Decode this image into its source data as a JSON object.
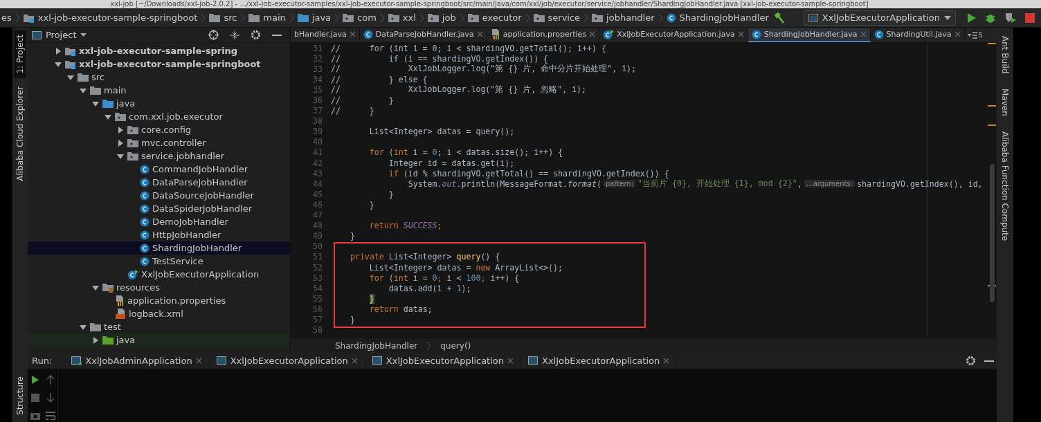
{
  "window": {
    "title": "xxl-job [~/Downloads/xxl-job-2.0.2] - .../xxl-job-executor-samples/xxl-job-executor-sample-springboot/src/main/java/com/xxl/job/executor/service/jobhandler/ShardingJobHandler.java [xxl-job-executor-sample-springboot]"
  },
  "navbar": {
    "crumbs": [
      {
        "label": "es",
        "kind": "none"
      },
      {
        "label": "xxl-job-executor-sample-springboot",
        "kind": "module"
      },
      {
        "label": "src",
        "kind": "folder"
      },
      {
        "label": "main",
        "kind": "folder"
      },
      {
        "label": "java",
        "kind": "source"
      },
      {
        "label": "com",
        "kind": "package"
      },
      {
        "label": "xxl",
        "kind": "package"
      },
      {
        "label": "job",
        "kind": "package"
      },
      {
        "label": "executor",
        "kind": "package"
      },
      {
        "label": "service",
        "kind": "package"
      },
      {
        "label": "jobhandler",
        "kind": "package"
      },
      {
        "label": "ShardingJobHandler",
        "kind": "class"
      }
    ],
    "run_config": "XxlJobExecutorApplication"
  },
  "left_stripe": {
    "top": [
      {
        "label": "1: Project",
        "selected": true
      },
      {
        "label": "Alibaba Cloud Explorer",
        "selected": false
      }
    ],
    "bottom": [
      {
        "label": "Structure",
        "selected": false
      }
    ]
  },
  "right_stripe": [
    {
      "label": "Ant Build"
    },
    {
      "label": "Maven"
    },
    {
      "label": "Alibaba Function Compute"
    }
  ],
  "project": {
    "title": "Project",
    "tree": [
      {
        "label": "xxl-job-executor-sample-spring",
        "kind": "module",
        "expanded": false,
        "selected": false
      },
      {
        "label": "xxl-job-executor-sample-springboot",
        "kind": "module",
        "expanded": true,
        "selected": false,
        "children": [
          {
            "label": "src",
            "kind": "folder",
            "expanded": true,
            "selected": false,
            "children": [
              {
                "label": "main",
                "kind": "folder",
                "expanded": true,
                "selected": false,
                "children": [
                  {
                    "label": "java",
                    "kind": "source",
                    "expanded": true,
                    "selected": false,
                    "children": [
                      {
                        "label": "com.xxl.job.executor",
                        "kind": "package",
                        "expanded": true,
                        "selected": false,
                        "children": [
                          {
                            "label": "core.config",
                            "kind": "package",
                            "expanded": false,
                            "selected": false
                          },
                          {
                            "label": "mvc.controller",
                            "kind": "package",
                            "expanded": false,
                            "selected": false
                          },
                          {
                            "label": "service.jobhandler",
                            "kind": "package",
                            "expanded": true,
                            "selected": false,
                            "children": [
                              {
                                "label": "CommandJobHandler",
                                "kind": "class",
                                "selected": false
                              },
                              {
                                "label": "DataParseJobHandler",
                                "kind": "class",
                                "selected": false
                              },
                              {
                                "label": "DataSourceJobHandler",
                                "kind": "class",
                                "selected": false
                              },
                              {
                                "label": "DataSpiderJobHandler",
                                "kind": "class",
                                "selected": false
                              },
                              {
                                "label": "DemoJobHandler",
                                "kind": "class",
                                "selected": false
                              },
                              {
                                "label": "HttpJobHandler",
                                "kind": "class",
                                "selected": false
                              },
                              {
                                "label": "ShardingJobHandler",
                                "kind": "class",
                                "selected": true
                              },
                              {
                                "label": "TestService",
                                "kind": "class",
                                "selected": false
                              }
                            ]
                          },
                          {
                            "label": "XxlJobExecutorApplication",
                            "kind": "app",
                            "selected": false
                          }
                        ]
                      }
                    ]
                  },
                  {
                    "label": "resources",
                    "kind": "resources",
                    "expanded": true,
                    "selected": false,
                    "children": [
                      {
                        "label": "application.properties",
                        "kind": "properties",
                        "selected": false
                      },
                      {
                        "label": "logback.xml",
                        "kind": "xml",
                        "selected": false
                      }
                    ]
                  }
                ]
              },
              {
                "label": "test",
                "kind": "folder",
                "expanded": true,
                "selected": false,
                "children": [
                  {
                    "label": "java",
                    "kind": "test",
                    "expanded": false,
                    "selected": false
                  }
                ]
              }
            ]
          }
        ]
      }
    ]
  },
  "editor": {
    "tabs": [
      {
        "label": "bHandler.java",
        "selected": false
      },
      {
        "label": "DataParseJobHandler.java",
        "kind": "class",
        "selected": false
      },
      {
        "label": "application.properties",
        "kind": "properties",
        "selected": false
      },
      {
        "label": "XxlJobExecutorApplication.java",
        "kind": "app",
        "selected": false
      },
      {
        "label": "ShardingJobHandler.java",
        "kind": "class",
        "selected": true
      },
      {
        "label": "ShardingUtil.java",
        "kind": "class",
        "selected": false
      }
    ],
    "overflow_count": "5",
    "lines": [
      {
        "no": "31",
        "tokens": [
          {
            "kind": "plain",
            "text": "//      for (int i = 0; i < shardingVO.getTotal(); i++) {"
          }
        ]
      },
      {
        "no": "32",
        "tokens": [
          {
            "kind": "plain",
            "text": "//          if (i == shardingVO.getIndex()) {"
          }
        ]
      },
      {
        "no": "33",
        "tokens": [
          {
            "kind": "plain",
            "text": "//              XxlJobLogger.log(\"第 {} 片, 命中分片开始处理\", i);"
          }
        ]
      },
      {
        "no": "34",
        "tokens": [
          {
            "kind": "plain",
            "text": "//          } else {"
          }
        ]
      },
      {
        "no": "35",
        "tokens": [
          {
            "kind": "plain",
            "text": "//              XxlJobLogger.log(\"第 {} 片, 忽略\", i);"
          }
        ]
      },
      {
        "no": "36",
        "tokens": [
          {
            "kind": "plain",
            "text": "//          }"
          }
        ]
      },
      {
        "no": "37",
        "tokens": [
          {
            "kind": "plain",
            "text": "//      }"
          }
        ]
      },
      {
        "no": "38"
      },
      {
        "no": "39",
        "tokens": [
          {
            "kind": "plain",
            "text": "        List<Integer> datas = query();"
          }
        ]
      },
      {
        "no": "40"
      },
      {
        "no": "41",
        "tokens": [
          {
            "kind": "keyword",
            "text": "        for"
          },
          {
            "kind": "plain",
            "text": " ("
          },
          {
            "kind": "keyword",
            "text": "int"
          },
          {
            "kind": "plain",
            "text": " i = "
          },
          {
            "kind": "number",
            "text": "0"
          },
          {
            "kind": "plain",
            "text": "; i < datas.size(); i++) {"
          }
        ]
      },
      {
        "no": "42",
        "tokens": [
          {
            "kind": "plain",
            "text": "            Integer id = datas.get(i);"
          }
        ]
      },
      {
        "no": "43",
        "tokens": [
          {
            "kind": "keyword",
            "text": "            if"
          },
          {
            "kind": "plain",
            "text": " (id % shardingVO.getTotal() == shardingVO.getIndex()) {"
          }
        ]
      },
      {
        "no": "44",
        "tokens": [
          {
            "kind": "plain",
            "text": "                System."
          },
          {
            "kind": "field",
            "text": "out"
          },
          {
            "kind": "plain",
            "text": ".println(MessageFormat."
          },
          {
            "kind": "static",
            "text": "format"
          },
          {
            "kind": "plain",
            "text": "("
          },
          {
            "kind": "hint",
            "text": "pattern:"
          },
          {
            "kind": "string",
            "text": "\"当前片 {0}, 开始处理 {1}, mod {2}\""
          },
          {
            "kind": "plain",
            "text": ","
          },
          {
            "kind": "hint",
            "text": "…arguments:"
          },
          {
            "kind": "plain",
            "text": "shardingVO.getIndex(), id,"
          }
        ]
      },
      {
        "no": "45",
        "tokens": [
          {
            "kind": "plain",
            "text": "            }"
          }
        ]
      },
      {
        "no": "46",
        "tokens": [
          {
            "kind": "plain",
            "text": "        }"
          }
        ]
      },
      {
        "no": "47"
      },
      {
        "no": "48",
        "tokens": [
          {
            "kind": "keyword",
            "text": "        return"
          },
          {
            "kind": "field",
            "text": " SUCCESS"
          },
          {
            "kind": "keyword",
            "text": ";"
          }
        ]
      },
      {
        "no": "49",
        "tokens": [
          {
            "kind": "plain",
            "text": "    }"
          }
        ]
      },
      {
        "no": "50"
      },
      {
        "no": "51",
        "tokens": [
          {
            "kind": "keyword",
            "text": "    private"
          },
          {
            "kind": "plain",
            "text": " List<Integer> "
          },
          {
            "kind": "method",
            "text": "query"
          },
          {
            "kind": "plain",
            "text": "() {"
          }
        ]
      },
      {
        "no": "52",
        "tokens": [
          {
            "kind": "plain",
            "text": "        List<Integer> datas = "
          },
          {
            "kind": "keyword",
            "text": "new"
          },
          {
            "kind": "plain",
            "text": " ArrayList<>();"
          }
        ]
      },
      {
        "no": "53",
        "tokens": [
          {
            "kind": "keyword",
            "text": "        for"
          },
          {
            "kind": "plain",
            "text": " ("
          },
          {
            "kind": "keyword",
            "text": "int"
          },
          {
            "kind": "plain",
            "text": " i = "
          },
          {
            "kind": "number",
            "text": "0"
          },
          {
            "kind": "keyword",
            "text": ";"
          },
          {
            "kind": "plain",
            "text": " i < "
          },
          {
            "kind": "number",
            "text": "100"
          },
          {
            "kind": "keyword",
            "text": ";"
          },
          {
            "kind": "plain",
            "text": " i++) {"
          }
        ]
      },
      {
        "no": "54",
        "tokens": [
          {
            "kind": "plain",
            "text": "            datas.add(i + "
          },
          {
            "kind": "number",
            "text": "1"
          },
          {
            "kind": "plain",
            "text": ");"
          }
        ]
      },
      {
        "no": "55",
        "tokens": [
          {
            "kind": "match",
            "text": "        }"
          }
        ]
      },
      {
        "no": "56",
        "tokens": [
          {
            "kind": "keyword",
            "text": "        return"
          },
          {
            "kind": "plain",
            "text": " datas;"
          }
        ]
      },
      {
        "no": "57",
        "tokens": [
          {
            "kind": "plain",
            "text": "    }"
          }
        ]
      },
      {
        "no": "58"
      }
    ],
    "breadcrumbs": [
      "ShardingJobHandler",
      "query()"
    ]
  },
  "run": {
    "label": "Run:",
    "tabs": [
      {
        "label": "XxlJobAdminApplication",
        "running": true
      },
      {
        "label": "XxlJobExecutorApplication",
        "running": false
      },
      {
        "label": "XxlJobExecutorApplication",
        "running": false
      },
      {
        "label": "XxlJobExecutorApplication",
        "running": false
      }
    ]
  }
}
